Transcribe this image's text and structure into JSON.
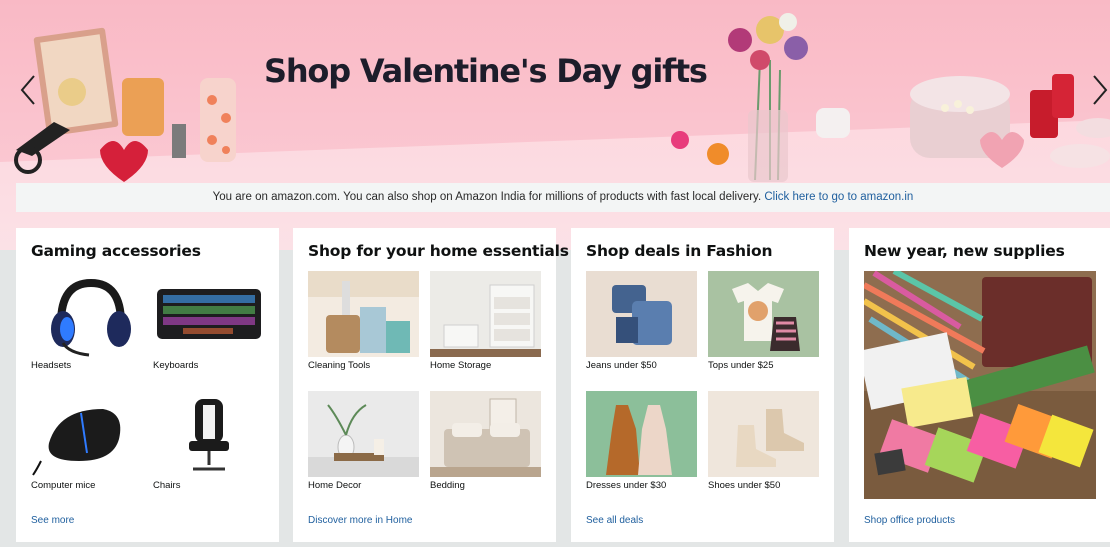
{
  "hero": {
    "title": "Shop Valentine's Day gifts",
    "prev_label": "Previous slide",
    "next_label": "Next slide"
  },
  "notice": {
    "text": "You are on amazon.com. You can also shop on Amazon India for millions of products with fast local delivery.",
    "link": "Click here to go to amazon.in"
  },
  "cards": [
    {
      "title": "Gaming accessories",
      "items": [
        {
          "label": "Headsets",
          "icon": "headset-image"
        },
        {
          "label": "Keyboards",
          "icon": "keyboard-image"
        },
        {
          "label": "Computer mice",
          "icon": "mouse-image"
        },
        {
          "label": "Chairs",
          "icon": "chair-image"
        }
      ],
      "link": "See more"
    },
    {
      "title": "Shop for your home essentials",
      "items": [
        {
          "label": "Cleaning Tools",
          "icon": "cleaning-tools-image"
        },
        {
          "label": "Home Storage",
          "icon": "home-storage-image"
        },
        {
          "label": "Home Decor",
          "icon": "home-decor-image"
        },
        {
          "label": "Bedding",
          "icon": "bedding-image"
        }
      ],
      "link": "Discover more in Home"
    },
    {
      "title": "Shop deals in Fashion",
      "items": [
        {
          "label": "Jeans under $50",
          "icon": "jeans-image"
        },
        {
          "label": "Tops under $25",
          "icon": "tops-image"
        },
        {
          "label": "Dresses under $30",
          "icon": "dresses-image"
        },
        {
          "label": "Shoes under $50",
          "icon": "shoes-image"
        }
      ],
      "link": "See all deals"
    },
    {
      "title": "New year, new supplies",
      "image": "office-supplies-image",
      "link": "Shop office products"
    }
  ],
  "colors": {
    "banner": "#f9b9c5",
    "link": "#1f5f9e",
    "page_bg": "#e3e6e6"
  }
}
